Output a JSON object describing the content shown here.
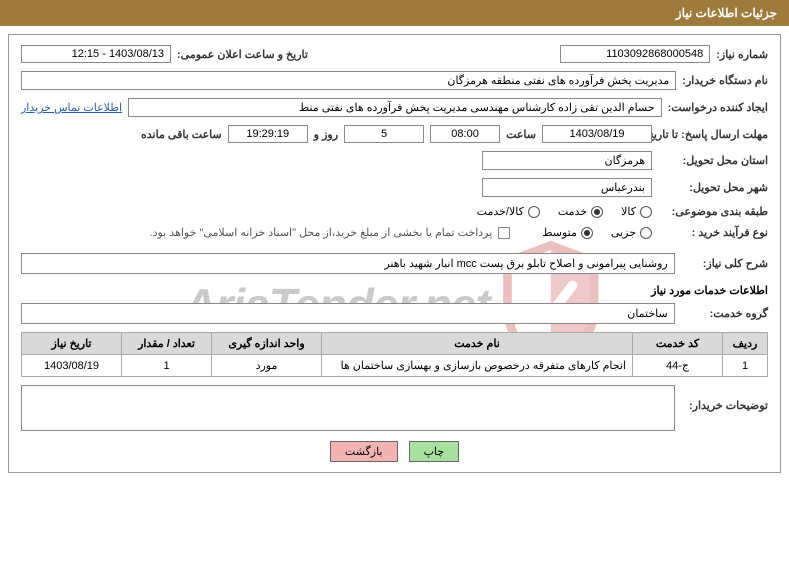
{
  "header": {
    "title": "جزئیات اطلاعات نیاز"
  },
  "fields": {
    "need_number_label": "شماره نیاز:",
    "need_number": "1103092868000548",
    "announce_datetime_label": "تاریخ و ساعت اعلان عمومی:",
    "announce_datetime": "1403/08/13 - 12:15",
    "buyer_org_label": "نام دستگاه خریدار:",
    "buyer_org": "مدیریت پخش فرآورده های نفتی منطقه هرمزگان",
    "requester_label": "ایجاد کننده درخواست:",
    "requester": "حسام الدین تقی زاده کارشناس مهندسی مدیریت پخش فرآورده های نفتی منط",
    "buyer_contact_link": "اطلاعات تماس خریدار",
    "deadline_label": "مهلت ارسال پاسخ: تا تاریخ:",
    "deadline_date": "1403/08/19",
    "time_label": "ساعت",
    "deadline_time": "08:00",
    "days_count": "5",
    "days_and_label": "روز و",
    "countdown": "19:29:19",
    "remain_label": "ساعت باقی مانده",
    "province_label": "استان محل تحویل:",
    "province": "هرمزگان",
    "city_label": "شهر محل تحویل:",
    "city": "بندرعباس",
    "subject_class_label": "طبقه بندی موضوعی:",
    "purchase_type_label": "نوع فرآیند خرید :",
    "payment_note": "پرداخت تمام یا بخشی از مبلغ خرید،از محل \"اسناد خزانه اسلامی\" خواهد بود.",
    "summary_label": "شرح کلی نیاز:",
    "summary": "روشنایی پیرامونی و اصلاح تابلو برق پست mcc انبار شهید باهنر",
    "services_section_label": "اطلاعات خدمات مورد نیاز",
    "service_group_label": "گروه خدمت:",
    "service_group": "ساختمان",
    "buyer_notes_label": "توضیحات خریدار:"
  },
  "radios": {
    "subject": {
      "options": [
        {
          "label": "کالا",
          "value": "goods",
          "selected": false
        },
        {
          "label": "خدمت",
          "value": "service",
          "selected": true
        },
        {
          "label": "کالا/خدمت",
          "value": "both",
          "selected": false
        }
      ]
    },
    "purchase_type": {
      "options": [
        {
          "label": "جزیی",
          "value": "minor",
          "selected": false
        },
        {
          "label": "متوسط",
          "value": "medium",
          "selected": true
        }
      ]
    }
  },
  "table": {
    "headers": {
      "row_no": "ردیف",
      "service_code": "کد خدمت",
      "service_name": "نام خدمت",
      "unit": "واحد اندازه گیری",
      "qty": "تعداد / مقدار",
      "need_date": "تاریخ نیاز"
    },
    "rows": [
      {
        "row_no": "1",
        "service_code": "ج-44",
        "service_name": "انجام کارهای متفرقه درخصوص بازسازی و بهسازی ساختمان ها",
        "unit": "مورد",
        "qty": "1",
        "need_date": "1403/08/19"
      }
    ]
  },
  "buttons": {
    "print": "چاپ",
    "back": "بازگشت"
  },
  "watermark": {
    "text": "AriaTender.net"
  }
}
